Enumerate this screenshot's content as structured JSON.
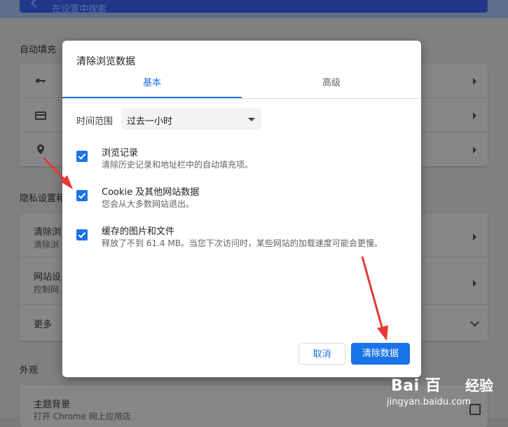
{
  "background_page": {
    "search_placeholder": "在设置中搜索",
    "autofill_section_title": "自动填充",
    "privacy_section_title": "隐私设置和",
    "privacy_rows": [
      {
        "title": "清除浏",
        "subtitle": "清除浏"
      },
      {
        "title": "网站设",
        "subtitle": "控制网"
      },
      {
        "title": "更多"
      }
    ],
    "appearance_section_title": "外观",
    "appearance_rows": [
      {
        "title": "主题背景",
        "subtitle": "打开 Chrome 网上应用店"
      }
    ]
  },
  "dialog": {
    "title": "清除浏览数据",
    "tabs": [
      {
        "label": "基本",
        "active": true
      },
      {
        "label": "高级",
        "active": false
      }
    ],
    "time_range_label": "时间范围",
    "time_range_value": "过去一小时",
    "options": [
      {
        "title": "浏览记录",
        "subtitle": "清除历史记录和地址栏中的自动填充项。",
        "checked": true
      },
      {
        "title": "Cookie 及其他网站数据",
        "subtitle": "您会从大多数网站退出。",
        "checked": true
      },
      {
        "title": "缓存的图片和文件",
        "subtitle": "释放了不到 61.4 MB。当您下次访问时，某些网站的加载速度可能会更慢。",
        "checked": true
      }
    ],
    "cancel_label": "取消",
    "clear_label": "清除数据"
  },
  "watermark": {
    "logo": "Bai 百",
    "logo_suffix": "经验",
    "url": "jingyan.baidu.com"
  },
  "colors": {
    "accent": "#1a73e8",
    "annotation_arrow": "#e53935"
  }
}
